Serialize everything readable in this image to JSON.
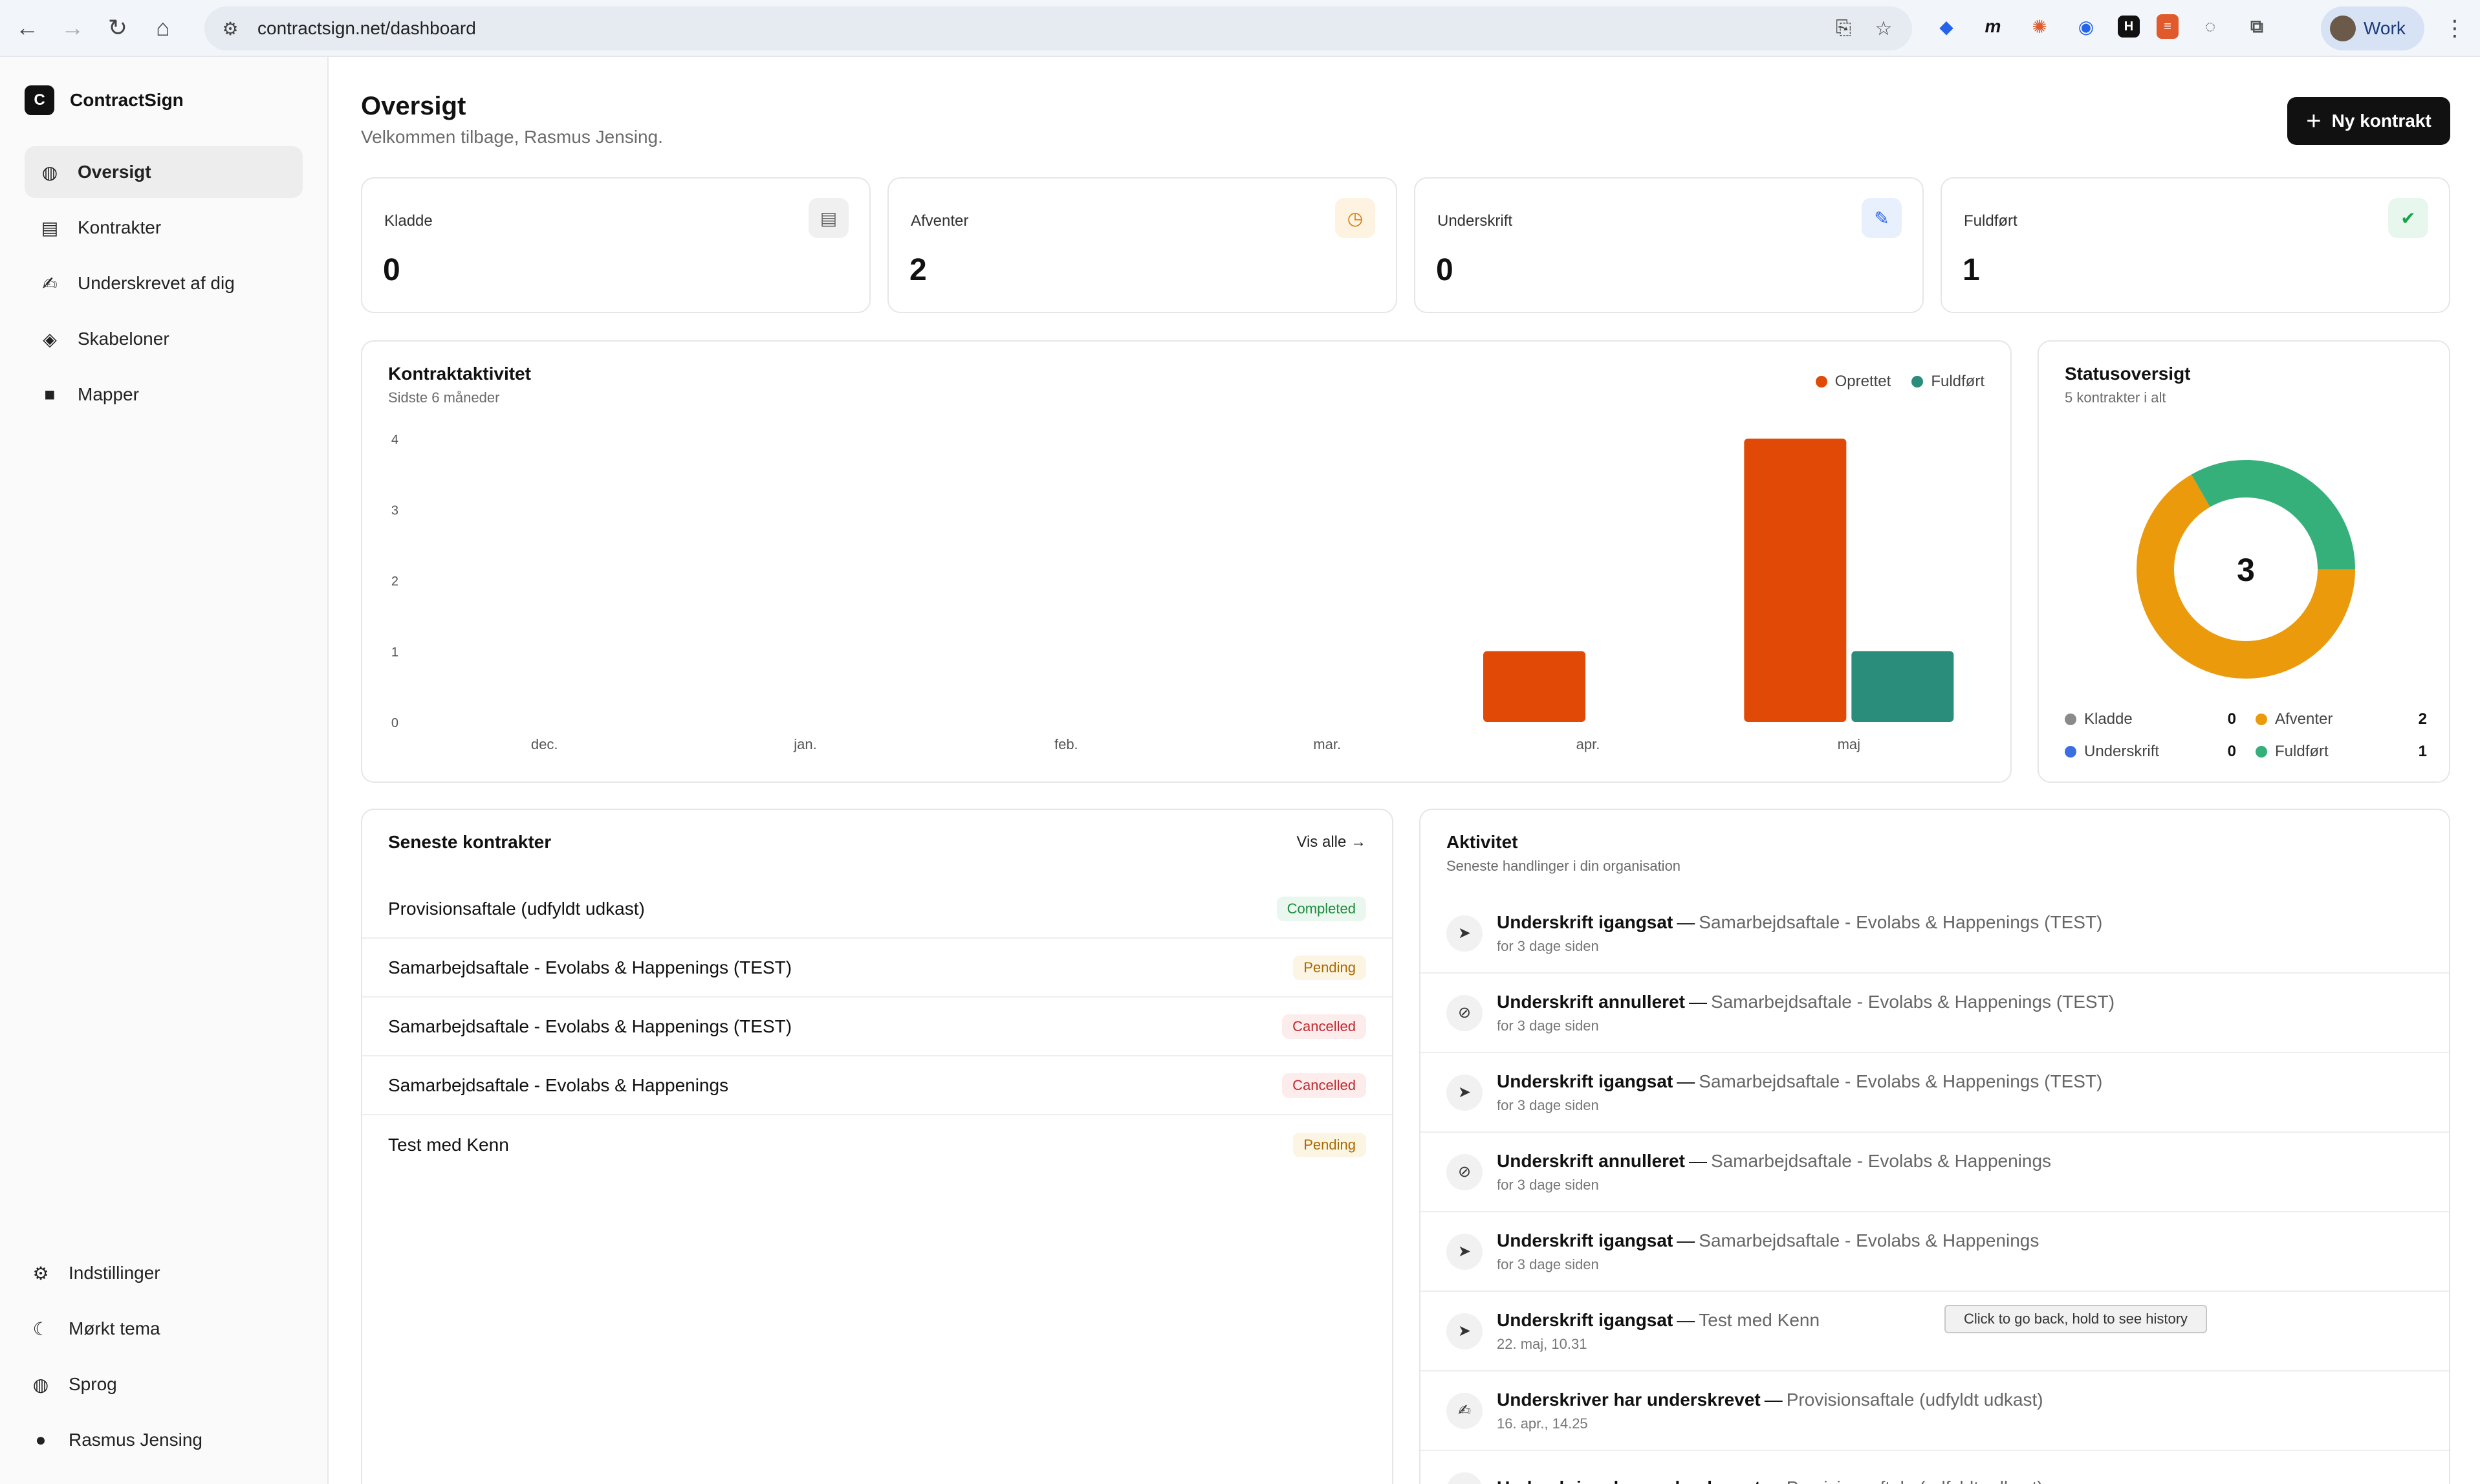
{
  "browser": {
    "url": "contractsign.net/dashboard",
    "profile_label": "Work"
  },
  "sidebar": {
    "brand_logo": "C",
    "brand_name": "ContractSign",
    "items": [
      {
        "label": "Oversigt",
        "icon": "globe-icon"
      },
      {
        "label": "Kontrakter",
        "icon": "file-icon"
      },
      {
        "label": "Underskrevet af dig",
        "icon": "signature-icon"
      },
      {
        "label": "Skabeloner",
        "icon": "layers-icon"
      },
      {
        "label": "Mapper",
        "icon": "folder-icon"
      }
    ],
    "bottom_items": [
      {
        "label": "Indstillinger",
        "icon": "gear-icon"
      },
      {
        "label": "Mørkt tema",
        "icon": "moon-icon"
      },
      {
        "label": "Sprog",
        "icon": "globe-icon"
      },
      {
        "label": "Rasmus Jensing",
        "icon": "user-icon"
      }
    ]
  },
  "header": {
    "title": "Oversigt",
    "subtitle": "Velkommen tilbage, Rasmus Jensing.",
    "new_button": "Ny kontrakt"
  },
  "stats": [
    {
      "label": "Kladde",
      "value": "0",
      "icon": "document-icon",
      "color": "#666666"
    },
    {
      "label": "Afventer",
      "value": "2",
      "icon": "clock-icon",
      "color": "#d97706"
    },
    {
      "label": "Underskrift",
      "value": "0",
      "icon": "signature-icon",
      "color": "#2563eb"
    },
    {
      "label": "Fuldført",
      "value": "1",
      "icon": "check-circle-icon",
      "color": "#16a34a"
    }
  ],
  "activity_chart": {
    "title": "Kontraktaktivitet",
    "subtitle": "Sidste 6 måneder"
  },
  "chart_data": {
    "type": "bar",
    "categories": [
      "dec.",
      "jan.",
      "feb.",
      "mar.",
      "apr.",
      "maj"
    ],
    "series": [
      {
        "name": "Oprettet",
        "color": "#e04a06",
        "values": [
          0,
          0,
          0,
          0,
          1,
          4
        ]
      },
      {
        "name": "Fuldført",
        "color": "#2a8c7a",
        "values": [
          0,
          0,
          0,
          0,
          0,
          1
        ]
      }
    ],
    "yticks": [
      "0",
      "1",
      "2",
      "3",
      "4"
    ],
    "ylim": [
      0,
      4
    ],
    "legend": "top-right",
    "grid": false
  },
  "status_overview": {
    "title": "Statusoversigt",
    "subtitle": "5 kontrakter i alt",
    "center_value": "3",
    "items": [
      {
        "label": "Kladde",
        "value": "0",
        "color": "#8a8a8a"
      },
      {
        "label": "Afventer",
        "value": "2",
        "color": "#eb9a0c"
      },
      {
        "label": "Underskrift",
        "value": "0",
        "color": "#3b6fe0"
      },
      {
        "label": "Fuldført",
        "value": "1",
        "color": "#35b07a"
      }
    ],
    "donut_slices": [
      {
        "name": "Afventer",
        "value": 2,
        "color": "#eb9a0c"
      },
      {
        "name": "Fuldført",
        "value": 1,
        "color": "#35b07a"
      }
    ]
  },
  "recent": {
    "title": "Seneste kontrakter",
    "see_all": "Vis alle →",
    "rows": [
      {
        "name": "Provisionsaftale (udfyldt udkast)",
        "status": "Completed",
        "kind": "completed"
      },
      {
        "name": "Samarbejdsaftale - Evolabs & Happenings (TEST)",
        "status": "Pending",
        "kind": "pending"
      },
      {
        "name": "Samarbejdsaftale - Evolabs & Happenings (TEST)",
        "status": "Cancelled",
        "kind": "cancelled"
      },
      {
        "name": "Samarbejdsaftale - Evolabs & Happenings",
        "status": "Cancelled",
        "kind": "cancelled"
      },
      {
        "name": "Test med Kenn",
        "status": "Pending",
        "kind": "pending"
      }
    ]
  },
  "activity": {
    "title": "Aktivitet",
    "subtitle": "Seneste handlinger i din organisation",
    "rows": [
      {
        "action": "Underskrift igangsat",
        "target": "Samarbejdsaftale - Evolabs & Happenings (TEST)",
        "time": "for 3 dage siden",
        "icon": "send-icon"
      },
      {
        "action": "Underskrift annulleret",
        "target": "Samarbejdsaftale - Evolabs & Happenings (TEST)",
        "time": "for 3 dage siden",
        "icon": "ban-icon"
      },
      {
        "action": "Underskrift igangsat",
        "target": "Samarbejdsaftale - Evolabs & Happenings (TEST)",
        "time": "for 3 dage siden",
        "icon": "send-icon"
      },
      {
        "action": "Underskrift annulleret",
        "target": "Samarbejdsaftale - Evolabs & Happenings",
        "time": "for 3 dage siden",
        "icon": "ban-icon"
      },
      {
        "action": "Underskrift igangsat",
        "target": "Samarbejdsaftale - Evolabs & Happenings",
        "time": "for 3 dage siden",
        "icon": "send-icon"
      },
      {
        "action": "Underskrift igangsat",
        "target": "Test med Kenn",
        "time": "22. maj, 10.31",
        "icon": "send-icon"
      },
      {
        "action": "Underskriver har underskrevet",
        "target": "Provisionsaftale (udfyldt udkast)",
        "time": "16. apr., 14.25",
        "icon": "signature-icon"
      },
      {
        "action": "Underskriver har underskrevet",
        "target": "Provisionsaftale (udfyldt udkast)",
        "time": "",
        "icon": "signature-icon"
      }
    ]
  },
  "tooltip": "Click to go back, hold to see history"
}
